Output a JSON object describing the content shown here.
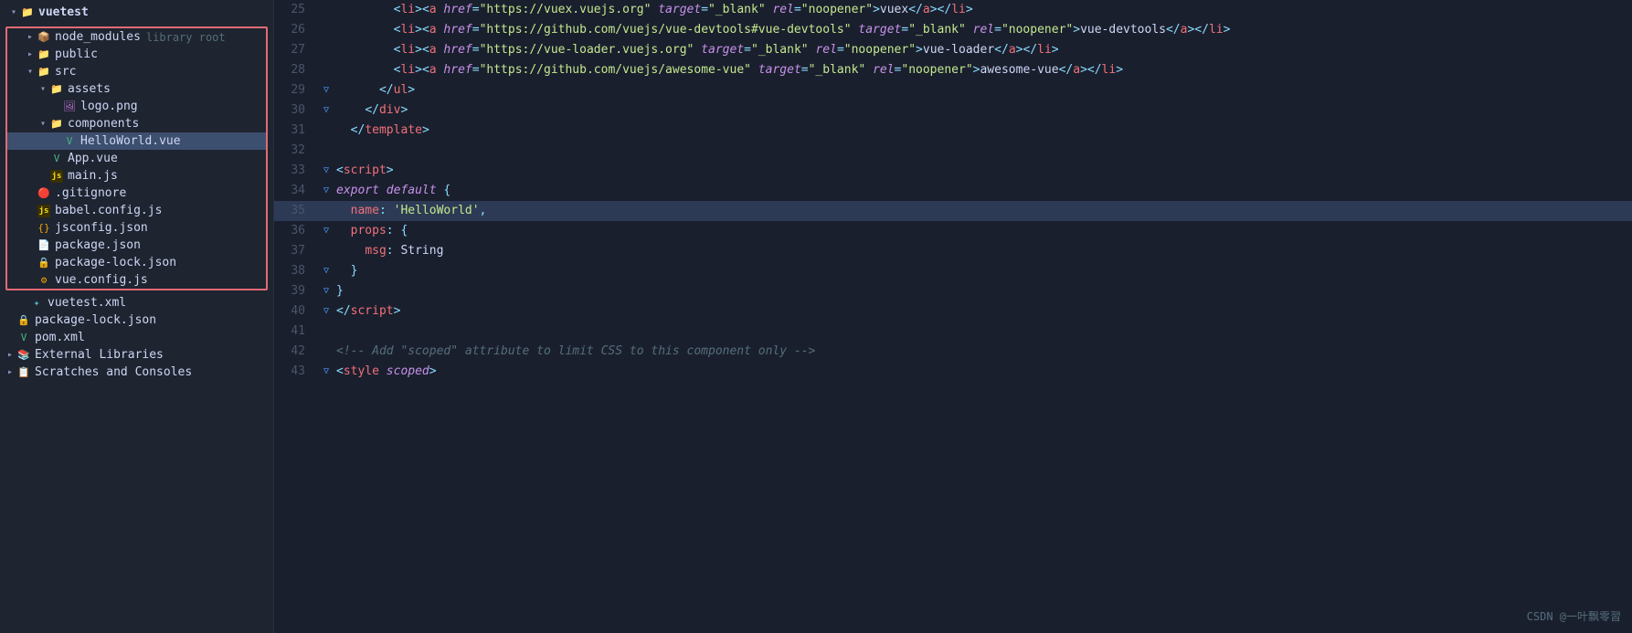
{
  "sidebar": {
    "root": "vuetest",
    "items": [
      {
        "id": "node_modules",
        "label": "node_modules",
        "suffix": "library root",
        "type": "dir",
        "indent": 1,
        "expanded": false,
        "icon": "node"
      },
      {
        "id": "public",
        "label": "public",
        "type": "dir",
        "indent": 1,
        "expanded": false,
        "icon": "folder"
      },
      {
        "id": "src",
        "label": "src",
        "type": "dir",
        "indent": 1,
        "expanded": true,
        "icon": "folder-src"
      },
      {
        "id": "assets",
        "label": "assets",
        "type": "dir",
        "indent": 2,
        "expanded": true,
        "icon": "folder"
      },
      {
        "id": "logo.png",
        "label": "logo.png",
        "type": "file",
        "indent": 3,
        "icon": "png"
      },
      {
        "id": "components",
        "label": "components",
        "type": "dir",
        "indent": 2,
        "expanded": true,
        "icon": "folder"
      },
      {
        "id": "HelloWorld.vue",
        "label": "HelloWorld.vue",
        "type": "file",
        "indent": 3,
        "icon": "vue",
        "active": true
      },
      {
        "id": "App.vue",
        "label": "App.vue",
        "type": "file",
        "indent": 2,
        "icon": "vue"
      },
      {
        "id": "main.js",
        "label": "main.js",
        "type": "file",
        "indent": 2,
        "icon": "js"
      },
      {
        "id": ".gitignore",
        "label": ".gitignore",
        "type": "file",
        "indent": 1,
        "icon": "gitignore"
      },
      {
        "id": "babel.config.js",
        "label": "babel.config.js",
        "type": "file",
        "indent": 1,
        "icon": "babel"
      },
      {
        "id": "jsconfig.json",
        "label": "jsconfig.json",
        "type": "file",
        "indent": 1,
        "icon": "json"
      },
      {
        "id": "package.json",
        "label": "package.json",
        "type": "file",
        "indent": 1,
        "icon": "pkg"
      },
      {
        "id": "package-lock.json",
        "label": "package-lock.json",
        "type": "file",
        "indent": 1,
        "icon": "pkg-lock"
      },
      {
        "id": "vue.config.js",
        "label": "vue.config.js",
        "type": "file",
        "indent": 1,
        "icon": "vueconfig"
      }
    ],
    "bottom_items": [
      {
        "id": "vuetest.xml",
        "label": "vuetest.xml",
        "type": "file",
        "indent": 1,
        "icon": "xml"
      },
      {
        "id": "package-lock-root.json",
        "label": "package-lock.json",
        "type": "file",
        "indent": 0,
        "icon": "pkg-lock"
      },
      {
        "id": "pom.xml",
        "label": "pom.xml",
        "type": "file",
        "indent": 0,
        "icon": "xml"
      },
      {
        "id": "External Libraries",
        "label": "External Libraries",
        "type": "dir",
        "indent": 0,
        "expanded": false,
        "icon": "ext"
      },
      {
        "id": "Scratches and Consoles",
        "label": "Scratches and Consoles",
        "type": "dir",
        "indent": 0,
        "expanded": false,
        "icon": "scratch"
      }
    ]
  },
  "editor": {
    "lines": [
      {
        "num": 25,
        "fold": "",
        "html": "<li_open><a href_attr>https://vuex.vuejs.org<href_close> target=<str>\"_blank\"</str> rel=<str>\"noopener\"</str>>vuex</a></li>"
      },
      {
        "num": 26,
        "fold": "",
        "html": ""
      },
      {
        "num": 27,
        "fold": "",
        "html": ""
      },
      {
        "num": 28,
        "fold": "",
        "html": ""
      },
      {
        "num": 29,
        "fold": "▽",
        "html": ""
      },
      {
        "num": 30,
        "fold": "▽",
        "html": ""
      },
      {
        "num": 31,
        "fold": "",
        "html": ""
      },
      {
        "num": 32,
        "fold": "",
        "html": ""
      },
      {
        "num": 33,
        "fold": "▽",
        "html": ""
      },
      {
        "num": 34,
        "fold": "▽",
        "html": ""
      },
      {
        "num": 35,
        "fold": "",
        "highlight": true,
        "html": ""
      },
      {
        "num": 36,
        "fold": "▽",
        "html": ""
      },
      {
        "num": 37,
        "fold": "",
        "html": ""
      },
      {
        "num": 38,
        "fold": "▽",
        "html": ""
      },
      {
        "num": 39,
        "fold": "▽",
        "html": ""
      },
      {
        "num": 40,
        "fold": "▽",
        "html": ""
      },
      {
        "num": 41,
        "fold": "",
        "html": ""
      },
      {
        "num": 42,
        "fold": "",
        "html": ""
      },
      {
        "num": 43,
        "fold": "▽",
        "html": ""
      }
    ]
  },
  "watermark": "CSDN @一叶飘零習"
}
